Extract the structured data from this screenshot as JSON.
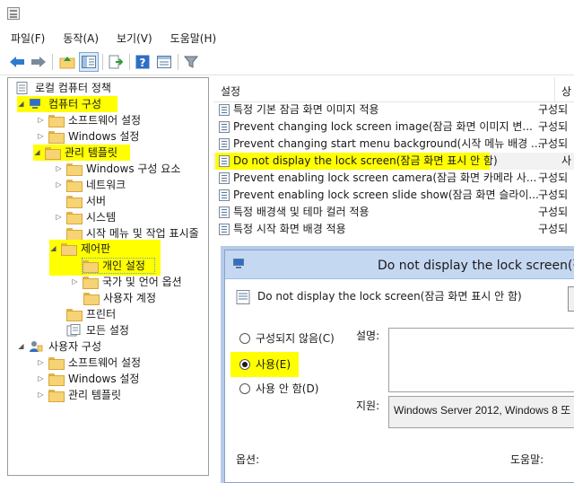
{
  "menubar": {
    "items": [
      "파일(F)",
      "동작(A)",
      "보기(V)",
      "도움말(H)"
    ]
  },
  "toolbar": {
    "icons": [
      "back-arrow-icon",
      "forward-arrow-icon",
      "up-folder-icon",
      "show-hide-tree-icon",
      "export-list-icon",
      "help-icon",
      "properties-icon",
      "filter-icon"
    ]
  },
  "tree": {
    "items": [
      {
        "label": "로컬 컴퓨터 정책"
      },
      {
        "label": "컴퓨터 구성"
      },
      {
        "label": "소프트웨어 설정"
      },
      {
        "label": "Windows 설정"
      },
      {
        "label": "관리 템플릿"
      },
      {
        "label": "Windows 구성 요소"
      },
      {
        "label": "네트워크"
      },
      {
        "label": "서버"
      },
      {
        "label": "시스템"
      },
      {
        "label": "시작 메뉴 및 작업 표시줄"
      },
      {
        "label": "제어판"
      },
      {
        "label": "개인 설정"
      },
      {
        "label": "국가 및 언어 옵션"
      },
      {
        "label": "사용자 계정"
      },
      {
        "label": "프린터"
      },
      {
        "label": "모든 설정"
      },
      {
        "label": "사용자 구성"
      },
      {
        "label": "소프트웨어 설정"
      },
      {
        "label": "Windows 설정"
      },
      {
        "label": "관리 템플릿"
      }
    ]
  },
  "list": {
    "header": {
      "setting": "설정",
      "state": "상"
    },
    "rows": [
      {
        "name": "특정 기본 잠금 화면 이미지 적용",
        "state": "구성되"
      },
      {
        "name": "Prevent changing lock screen image(잠금 화면 이미지 변...",
        "state": "구성되"
      },
      {
        "name": "Prevent changing start menu background(시작 메뉴 배경 ...",
        "state": "구성되"
      },
      {
        "name": "Do not display the lock screen(잠금 화면 표시 안 함)",
        "state": "사"
      },
      {
        "name": "Prevent enabling lock screen camera(잠금 화면 카메라 사...",
        "state": "구성되"
      },
      {
        "name": "Prevent enabling lock screen slide show(잠금 화면 슬라이...",
        "state": "구성되"
      },
      {
        "name": "특정 배경색 및 테마 컬러 적용",
        "state": "구성되"
      },
      {
        "name": "특정 시작 화면 배경 적용",
        "state": "구성되"
      }
    ]
  },
  "dialog": {
    "title": "Do not display the lock screen(잠",
    "subtitle": "Do not display the lock screen(잠금 화면 표시 안 함)",
    "radio_not_configured": "구성되지 않음(C)",
    "radio_enabled": "사용(E)",
    "radio_disabled": "사용 안 함(D)",
    "comment_label": "설명:",
    "supported_label": "지원:",
    "supported_value": "Windows Server 2012, Windows 8 또",
    "options_label": "옵션:",
    "help_label": "도움말:"
  },
  "colors": {
    "highlight": "#ffff00",
    "selection": "#cce8ff",
    "dialog_title": "#c5d8f2"
  }
}
